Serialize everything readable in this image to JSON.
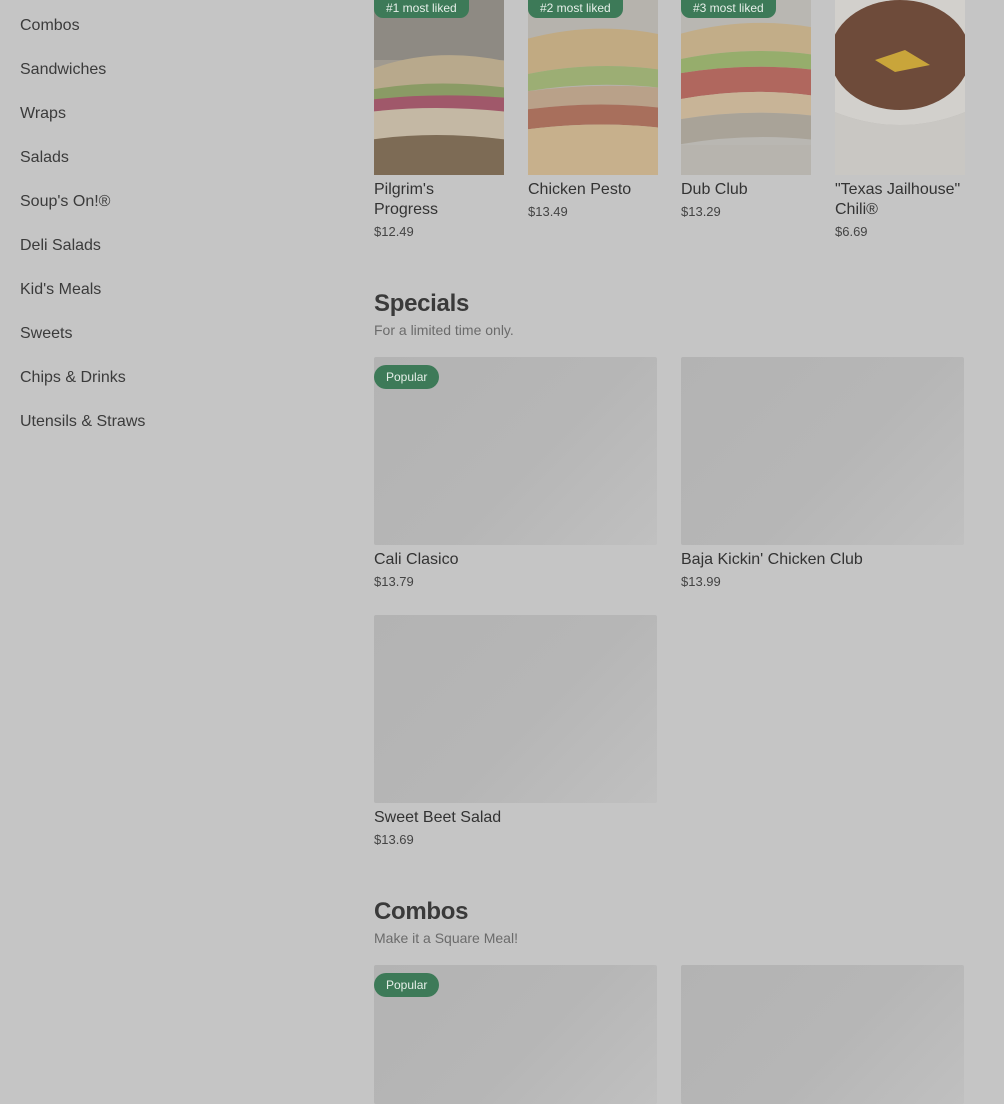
{
  "sidebar": {
    "items": [
      {
        "label": "Combos"
      },
      {
        "label": "Sandwiches"
      },
      {
        "label": "Wraps"
      },
      {
        "label": "Salads"
      },
      {
        "label": "Soup's On!®"
      },
      {
        "label": "Deli Salads"
      },
      {
        "label": "Kid's Meals"
      },
      {
        "label": "Sweets"
      },
      {
        "label": "Chips & Drinks"
      },
      {
        "label": "Utensils & Straws"
      }
    ]
  },
  "most_liked": [
    {
      "badge": "#1 most liked",
      "name_line1": "Pilgrim's",
      "name_line2": "Progress",
      "price": "$12.49"
    },
    {
      "badge": "#2 most liked",
      "name_line1": "Chicken Pesto",
      "name_line2": "",
      "price": "$13.49"
    },
    {
      "badge": "#3 most liked",
      "name_line1": "Dub Club",
      "name_line2": "",
      "price": "$13.29"
    },
    {
      "badge": "",
      "name_line1": "\"Texas Jailhouse\"",
      "name_line2": "Chili®",
      "price": "$6.69"
    }
  ],
  "specials": {
    "title": "Specials",
    "subtitle": "For a limited time only.",
    "items": [
      {
        "badge": "Popular",
        "name": "Cali Clasico",
        "price": "$13.79"
      },
      {
        "badge": "",
        "name": "Baja Kickin' Chicken Club",
        "price": "$13.99"
      },
      {
        "badge": "",
        "name": "Sweet Beet Salad",
        "price": "$13.69"
      }
    ]
  },
  "combos": {
    "title": "Combos",
    "subtitle": "Make it a Square Meal!",
    "items": [
      {
        "badge": "Popular"
      },
      {
        "badge": ""
      }
    ]
  },
  "colors": {
    "overlay_bg": "#c5c5c5",
    "badge_green": "#3d7a58",
    "placeholder": "#b5b5b5"
  }
}
